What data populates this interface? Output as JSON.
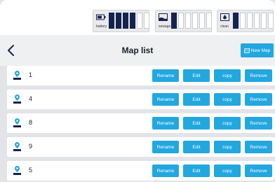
{
  "status": {
    "gauges": [
      {
        "label": "battery",
        "icon": "battery-icon",
        "bars": [
          true,
          true,
          true,
          true,
          false,
          false
        ]
      },
      {
        "label": "sewage",
        "icon": "sewage-tank-icon",
        "bars": [
          true,
          false,
          false,
          false,
          false,
          false
        ]
      },
      {
        "label": "clean",
        "icon": "clean-tank-icon",
        "bars": [
          true,
          false,
          false,
          false,
          false,
          false
        ]
      }
    ]
  },
  "header": {
    "title": "Map list",
    "new_map_label": "New Map"
  },
  "rows": [
    {
      "number": "1"
    },
    {
      "number": "4"
    },
    {
      "number": "8"
    },
    {
      "number": "9"
    },
    {
      "number": "5"
    }
  ],
  "actions": {
    "rename": "Rename",
    "edit": "Edit",
    "copy": "copy",
    "remove": "Remove"
  },
  "colors": {
    "accent": "#22a7df",
    "bar_fill": "#15234f",
    "background": "#e2e4e7"
  }
}
